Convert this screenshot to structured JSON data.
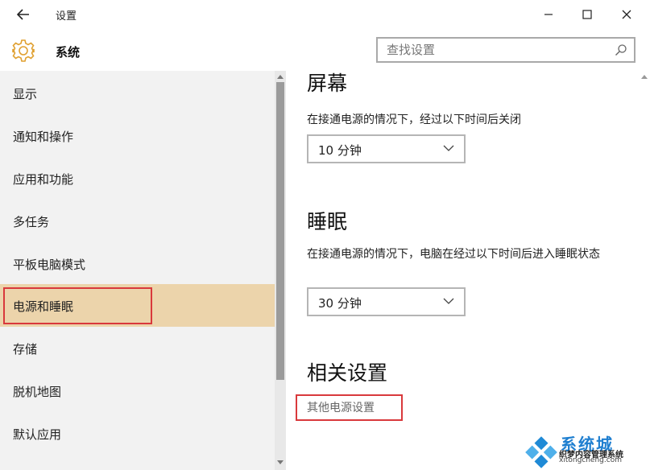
{
  "titlebar": {
    "title": "设置"
  },
  "header": {
    "title": "系统",
    "search_placeholder": "查找设置"
  },
  "sidebar": {
    "items": [
      {
        "label": "显示"
      },
      {
        "label": "通知和操作"
      },
      {
        "label": "应用和功能"
      },
      {
        "label": "多任务"
      },
      {
        "label": "平板电脑模式"
      },
      {
        "label": "电源和睡眠",
        "selected": true
      },
      {
        "label": "存储"
      },
      {
        "label": "脱机地图"
      },
      {
        "label": "默认应用"
      }
    ]
  },
  "main": {
    "screen": {
      "heading": "屏幕",
      "description": "在接通电源的情况下，经过以下时间后关闭",
      "value": "10 分钟"
    },
    "sleep": {
      "heading": "睡眠",
      "description": "在接通电源的情况下，电脑在经过以下时间后进入睡眠状态",
      "value": "30 分钟"
    },
    "related": {
      "heading": "相关设置",
      "link": "其他电源设置"
    }
  },
  "watermark": {
    "title": "系统城",
    "subtitle": "织梦内容管理系统",
    "domain": "xitongcheng.com"
  },
  "colors": {
    "selected_bg": "#ecd4ab",
    "highlight_border": "#d9393c",
    "sidebar_bg": "#f2f2f2",
    "gear_icon": "#e0a030"
  },
  "icons": [
    "back-arrow-icon",
    "minimize-icon",
    "maximize-icon",
    "close-icon",
    "gear-icon",
    "search-icon",
    "chevron-down-icon"
  ]
}
